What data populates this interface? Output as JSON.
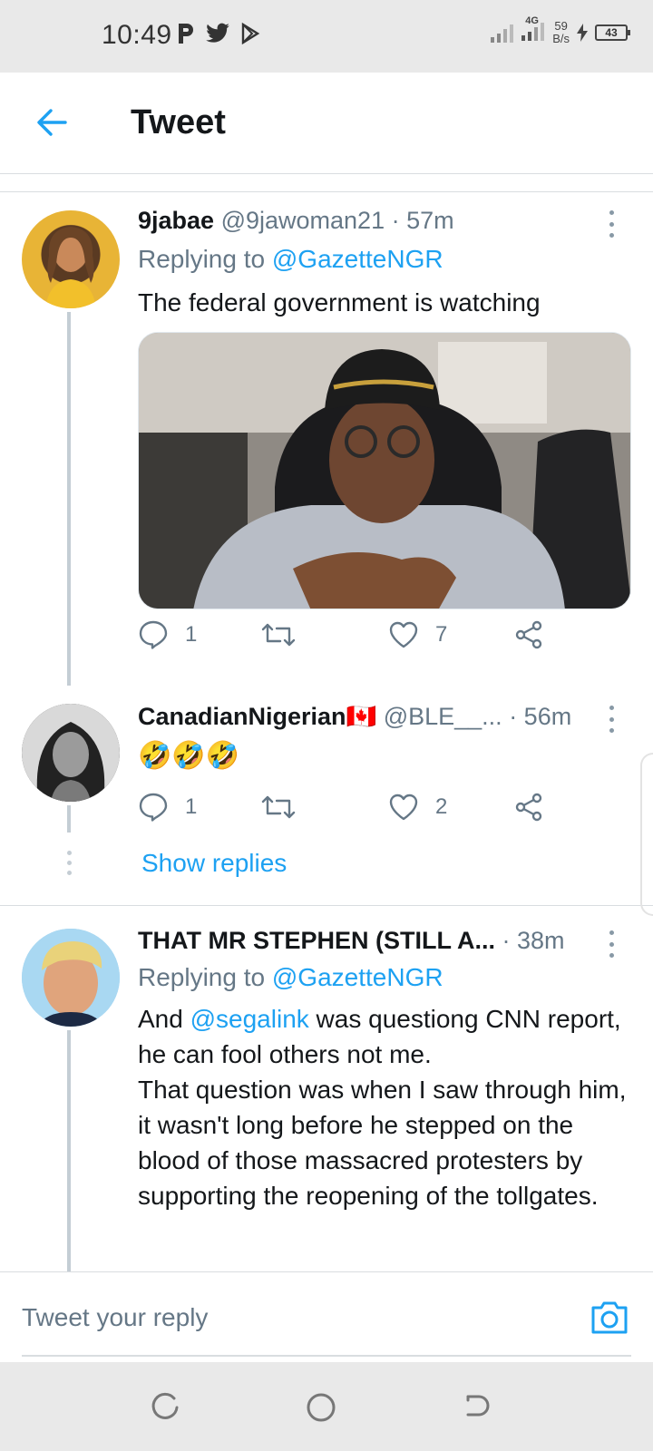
{
  "status_bar": {
    "time": "10:49",
    "network": "4G",
    "speed_value": "59",
    "speed_unit": "B/s",
    "battery": "43"
  },
  "header": {
    "title": "Tweet",
    "back_icon": "arrow-left-icon"
  },
  "tweets": [
    {
      "display_name": "9jabae",
      "handle": "@9jawoman21",
      "time": "· 57m",
      "replying_label": "Replying to",
      "replying_to": "@GazetteNGR",
      "text": "The federal government is watching",
      "reply_count": "1",
      "retweet_count": "",
      "like_count": "7"
    },
    {
      "display_name": "CanadianNigerian🇨🇦",
      "handle": "@BLE__...",
      "time": "· 56m",
      "text": "🤣🤣🤣",
      "reply_count": "1",
      "retweet_count": "",
      "like_count": "2"
    },
    {
      "display_name": "THAT MR STEPHEN (STILL A...",
      "time": "· 38m",
      "replying_label": "Replying to",
      "replying_to": "@GazetteNGR",
      "text_prefix": "And ",
      "text_mention": "@segalink",
      "text_suffix": " was questiong CNN report, he can fool others not me.",
      "text_line2": "That question was when I saw through him, it wasn't long before he stepped on the blood of those massacred protesters by supporting the reopening of the tollgates."
    }
  ],
  "show_replies": "Show replies",
  "composer": {
    "placeholder": "Tweet your reply"
  },
  "colors": {
    "accent": "#1da1f2",
    "secondary_text": "#657786",
    "thread_line": "#c4cdd4"
  }
}
